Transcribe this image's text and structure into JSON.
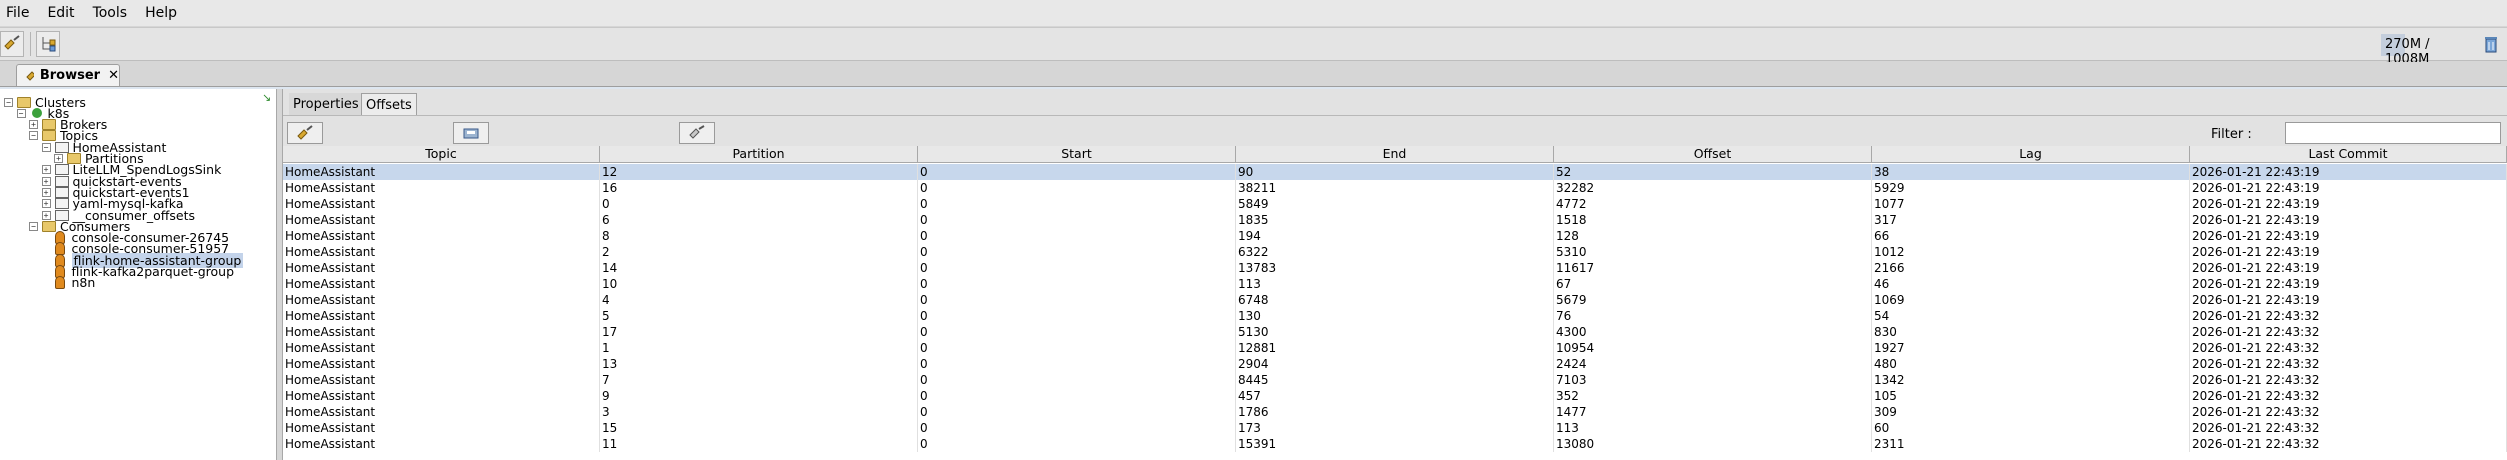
{
  "menu": {
    "items": [
      "File",
      "Edit",
      "Tools",
      "Help"
    ]
  },
  "toolbar": {
    "memory": "270M / 1008M",
    "memory_used_fraction": 0.268
  },
  "tab": {
    "label": "Browser",
    "close": "✕"
  },
  "tree": {
    "items": [
      {
        "label": "Clusters",
        "level": 0,
        "icon": "folder-icon",
        "toggle": "−"
      },
      {
        "label": "k8s",
        "level": 1,
        "icon": "cluster-connected-icon",
        "toggle": "−"
      },
      {
        "label": "Brokers",
        "level": 2,
        "icon": "folder-icon",
        "toggle": "+"
      },
      {
        "label": "Topics",
        "level": 2,
        "icon": "folder-icon",
        "toggle": "−"
      },
      {
        "label": "HomeAssistant",
        "level": 3,
        "icon": "topic-icon",
        "toggle": "−"
      },
      {
        "label": "Partitions",
        "level": 4,
        "icon": "folder-icon",
        "toggle": "+"
      },
      {
        "label": "LiteLLM_SpendLogsSink",
        "level": 3,
        "icon": "topic-icon",
        "toggle": "+"
      },
      {
        "label": "quickstart-events",
        "level": 3,
        "icon": "topic-icon",
        "toggle": "+"
      },
      {
        "label": "quickstart-events1",
        "level": 3,
        "icon": "topic-icon",
        "toggle": "+"
      },
      {
        "label": "yaml-mysql-kafka",
        "level": 3,
        "icon": "topic-icon",
        "toggle": "+"
      },
      {
        "label": "__consumer_offsets",
        "level": 3,
        "icon": "topic-icon",
        "toggle": "+"
      },
      {
        "label": "Consumers",
        "level": 2,
        "icon": "folder-icon",
        "toggle": "−"
      },
      {
        "label": "console-consumer-26745",
        "level": 3,
        "icon": "consumer-icon",
        "toggle": ""
      },
      {
        "label": "console-consumer-51957",
        "level": 3,
        "icon": "consumer-icon",
        "toggle": ""
      },
      {
        "label": "flink-home-assistant-group",
        "level": 3,
        "icon": "consumer-icon",
        "toggle": "",
        "selected": true
      },
      {
        "label": "flink-kafka2parquet-group",
        "level": 3,
        "icon": "consumer-icon",
        "toggle": ""
      },
      {
        "label": "n8n",
        "level": 3,
        "icon": "consumer-icon",
        "toggle": ""
      }
    ]
  },
  "panel": {
    "tabs": [
      "Properties",
      "Offsets"
    ],
    "filter_label": "Filter :",
    "filter_value": ""
  },
  "table": {
    "columns": [
      "Topic",
      "Partition",
      "Start",
      "End",
      "Offset",
      "Lag",
      "Last Commit"
    ],
    "rows": [
      [
        "HomeAssistant",
        "12",
        "0",
        "90",
        "52",
        "38",
        "2026-01-21 22:43:19"
      ],
      [
        "HomeAssistant",
        "16",
        "0",
        "38211",
        "32282",
        "5929",
        "2026-01-21 22:43:19"
      ],
      [
        "HomeAssistant",
        "0",
        "0",
        "5849",
        "4772",
        "1077",
        "2026-01-21 22:43:19"
      ],
      [
        "HomeAssistant",
        "6",
        "0",
        "1835",
        "1518",
        "317",
        "2026-01-21 22:43:19"
      ],
      [
        "HomeAssistant",
        "8",
        "0",
        "194",
        "128",
        "66",
        "2026-01-21 22:43:19"
      ],
      [
        "HomeAssistant",
        "2",
        "0",
        "6322",
        "5310",
        "1012",
        "2026-01-21 22:43:19"
      ],
      [
        "HomeAssistant",
        "14",
        "0",
        "13783",
        "11617",
        "2166",
        "2026-01-21 22:43:19"
      ],
      [
        "HomeAssistant",
        "10",
        "0",
        "113",
        "67",
        "46",
        "2026-01-21 22:43:19"
      ],
      [
        "HomeAssistant",
        "4",
        "0",
        "6748",
        "5679",
        "1069",
        "2026-01-21 22:43:19"
      ],
      [
        "HomeAssistant",
        "5",
        "0",
        "130",
        "76",
        "54",
        "2026-01-21 22:43:32"
      ],
      [
        "HomeAssistant",
        "17",
        "0",
        "5130",
        "4300",
        "830",
        "2026-01-21 22:43:32"
      ],
      [
        "HomeAssistant",
        "1",
        "0",
        "12881",
        "10954",
        "1927",
        "2026-01-21 22:43:32"
      ],
      [
        "HomeAssistant",
        "13",
        "0",
        "2904",
        "2424",
        "480",
        "2026-01-21 22:43:32"
      ],
      [
        "HomeAssistant",
        "7",
        "0",
        "8445",
        "7103",
        "1342",
        "2026-01-21 22:43:32"
      ],
      [
        "HomeAssistant",
        "9",
        "0",
        "457",
        "352",
        "105",
        "2026-01-21 22:43:32"
      ],
      [
        "HomeAssistant",
        "3",
        "0",
        "1786",
        "1477",
        "309",
        "2026-01-21 22:43:32"
      ],
      [
        "HomeAssistant",
        "15",
        "0",
        "173",
        "113",
        "60",
        "2026-01-21 22:43:32"
      ],
      [
        "HomeAssistant",
        "11",
        "0",
        "15391",
        "13080",
        "2311",
        "2026-01-21 22:43:32"
      ]
    ]
  }
}
